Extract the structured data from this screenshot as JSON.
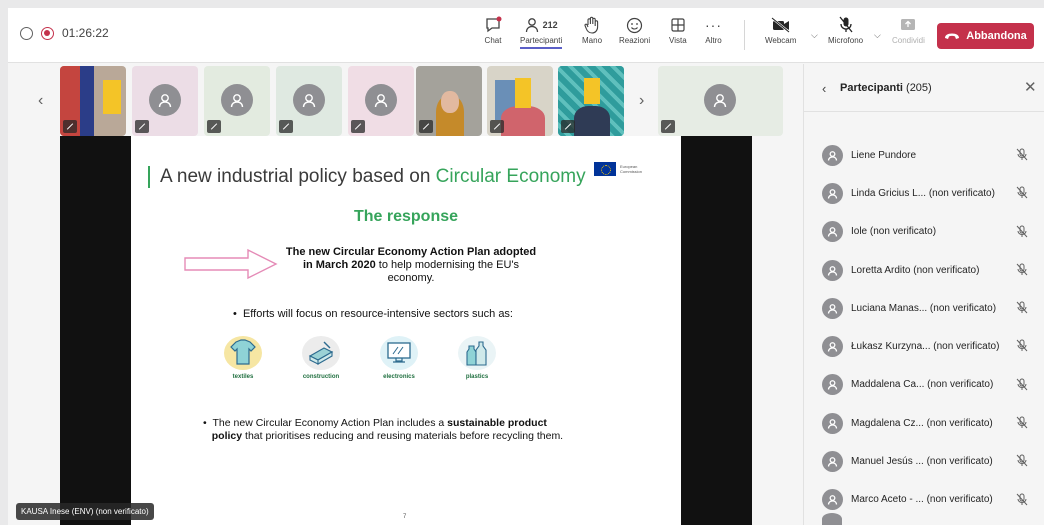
{
  "call": {
    "timer": "01:26:22"
  },
  "toolbar": {
    "chat": "Chat",
    "participants_count": "212",
    "participants": "Partecipanti",
    "hand": "Mano",
    "reactions": "Reazioni",
    "view": "Vista",
    "more": "Altro",
    "webcam": "Webcam",
    "mic": "Microfono",
    "share": "Condividi",
    "leave": "Abbandona"
  },
  "colors": {
    "accent": "#5b5fc7",
    "leave": "#c4314b",
    "slide_green": "#36a45b"
  },
  "slide": {
    "title_plain": "A new industrial policy based on",
    "title_accent": "Circular Economy",
    "eu_label_1": "European",
    "eu_label_2": "Commission",
    "heading": "The response",
    "plan_bold": "The new Circular Economy Action Plan adopted in March 2020",
    "plan_rest": "to help modernising the EU's economy.",
    "bullet1": "Efforts will focus on resource-intensive sectors such as:",
    "sectors": [
      "textiles",
      "construction",
      "electronics",
      "plastics"
    ],
    "bullet2_pre": "The new Circular Economy Action Plan includes a",
    "bullet2_bold1": "sustainable product",
    "bullet2_bold2": "policy",
    "bullet2_post": "that prioritises reducing and reusing materials before recycling them.",
    "page": "7"
  },
  "speaker_label": "KAUSA Inese (ENV) (non verificato)",
  "panel": {
    "title": "Partecipanti",
    "count": "(205)",
    "participants": [
      "Liene Pundore",
      "Linda Gricius L... (non verificato)",
      "Iole (non verificato)",
      "Loretta Ardito (non verificato)",
      "Luciana Manas... (non verificato)",
      "Łukasz Kurzyna... (non verificato)",
      "Maddalena Ca... (non verificato)",
      "Magdalena Cz... (non verificato)",
      "Manuel Jesús ... (non verificato)",
      "Marco Aceto - ... (non verificato)"
    ]
  }
}
